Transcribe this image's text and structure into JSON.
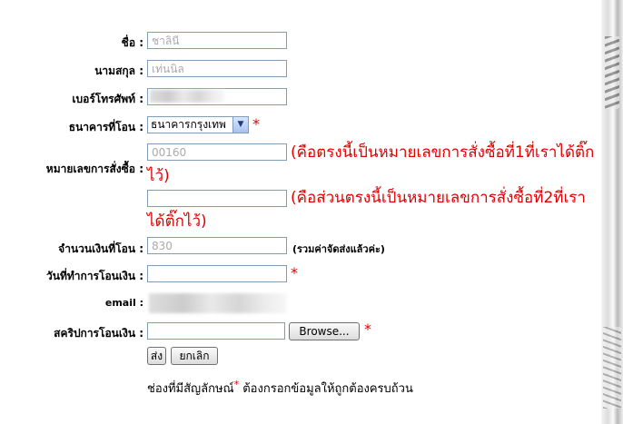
{
  "form": {
    "name": {
      "label": "ชื่อ :",
      "value": "ชาลินี"
    },
    "surname": {
      "label": "นามสกุล :",
      "value": "เท่นนิล"
    },
    "phone": {
      "label": "เบอร์โทรศัพท์ :",
      "value": ""
    },
    "bank": {
      "label": "ธนาคารที่โอน :",
      "selected": "ธนาคารกรุงเทพ"
    },
    "order_no": {
      "label": "หมายเลขการสั่งซื้อ :",
      "value": "00160",
      "note": "(คือตรงนี้เป็นหมายเลขการสั่งซื้อที่1ที่เราได้ติ๊กไว้)"
    },
    "order_no2": {
      "value": "",
      "note": "(คือส่วนตรงนี้เป็นหมายเลขการสั่งซื้อที่2ที่เราได้ติ๊กไว้)"
    },
    "amount": {
      "label": "จำนวนเงินที่โอน :",
      "value": "830",
      "hint": "(รวมค่าจัดส่งแล้วค่ะ)"
    },
    "date": {
      "label": "วันที่ทำการโอนเงิน :",
      "value": ""
    },
    "email": {
      "label": "email :"
    },
    "slip": {
      "label": "สคริปการโอนเงิน :",
      "value": "",
      "browse_label": "Browse..."
    },
    "required_mark": "*",
    "submit_label": "ส่ง",
    "cancel_label": "ยกเลิก",
    "footnote_prefix": "ช่องที่มีสัญลักษณ์",
    "footnote_star": "*",
    "footnote_suffix": " ต้องกรอกข้อมูลให้ถูกต้องครบถ้วน"
  },
  "colors": {
    "required": "#e00000",
    "input_border": "#7f9db9"
  }
}
